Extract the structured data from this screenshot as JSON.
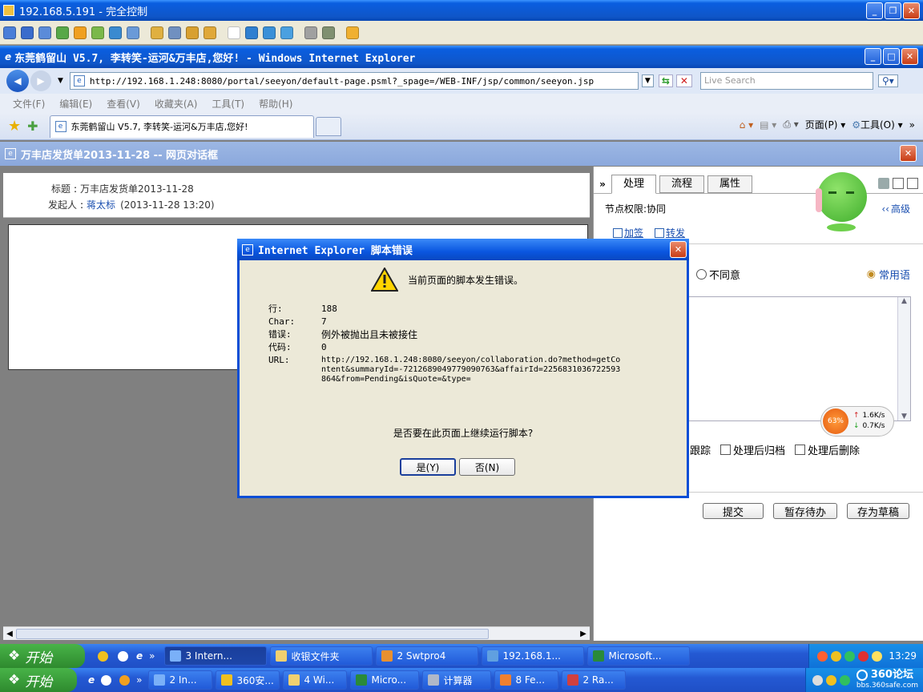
{
  "remote": {
    "title": "192.168.5.191 - 完全控制"
  },
  "ie": {
    "title": "东莞鹤留山 V5.7, 李转笑-运河&万丰店,您好! - Windows Internet Explorer",
    "url": "http://192.168.1.248:8080/portal/seeyon/default-page.psml?_spage=/WEB-INF/jsp/common/seeyon.jsp",
    "search_placeholder": "Live Search",
    "menu": [
      "文件(F)",
      "编辑(E)",
      "查看(V)",
      "收藏夹(A)",
      "工具(T)",
      "帮助(H)"
    ],
    "tab_title": "东莞鹤留山 V5.7, 李转笑-运河&万丰店,您好!",
    "cmd_page": "页面(P)",
    "cmd_tools": "工具(O)"
  },
  "dialog_window": {
    "title": "万丰店发货单2013-11-28 -- 网页对话框"
  },
  "doc": {
    "title_label": "标题",
    "title_value": "万丰店发货单2013-11-28",
    "sender_label": "发起人",
    "sender_name": "蒋太标",
    "sender_time": "(2013-11-28 13:20)"
  },
  "side": {
    "tabs": [
      "处理",
      "流程",
      "属性"
    ],
    "node_perm": "节点权限:协同",
    "add_sign": "加签",
    "forward": "转发",
    "advanced": "高级",
    "disagree": "不同意",
    "phrases": "常用语",
    "track_partial": "跟踪",
    "archive": "处理后归档",
    "delete_after": "处理后删除",
    "buttons": [
      "提交",
      "暂存待办",
      "存为草稿"
    ]
  },
  "net": {
    "percent": "63%",
    "up": "1.6K/s",
    "down": "0.7K/s"
  },
  "error": {
    "title": "Internet Explorer 脚本错误",
    "message": "当前页面的脚本发生错误。",
    "line_label": "行:",
    "line_value": "188",
    "char_label": "Char:",
    "char_value": "7",
    "err_label": "错误:",
    "err_value": "例外被抛出且未被接住",
    "code_label": "代码:",
    "code_value": "0",
    "url_label": "URL:",
    "url_value": "http://192.168.1.248:8080/seeyon/collaboration.do?method=getContent&summaryId=-7212689049779090763&affairId=2256831036722593864&from=Pending&isQuote=&type=",
    "question": "是否要在此页面上继续运行脚本?",
    "yes": "是(Y)",
    "no": "否(N)"
  },
  "taskbar1": {
    "start": "开始",
    "items": [
      "3 Intern...",
      "收银文件夹",
      "2 Swtpro4",
      "192.168.1...",
      "Microsoft..."
    ],
    "clock": "13:29"
  },
  "taskbar2": {
    "start": "开始",
    "items": [
      "2 In...",
      "360安...",
      "4 Wi...",
      "Micro...",
      "计算器",
      "8 Fe...",
      "2 Ra..."
    ],
    "brand": "360论坛",
    "brand_url": "bbs.360safe.com"
  }
}
